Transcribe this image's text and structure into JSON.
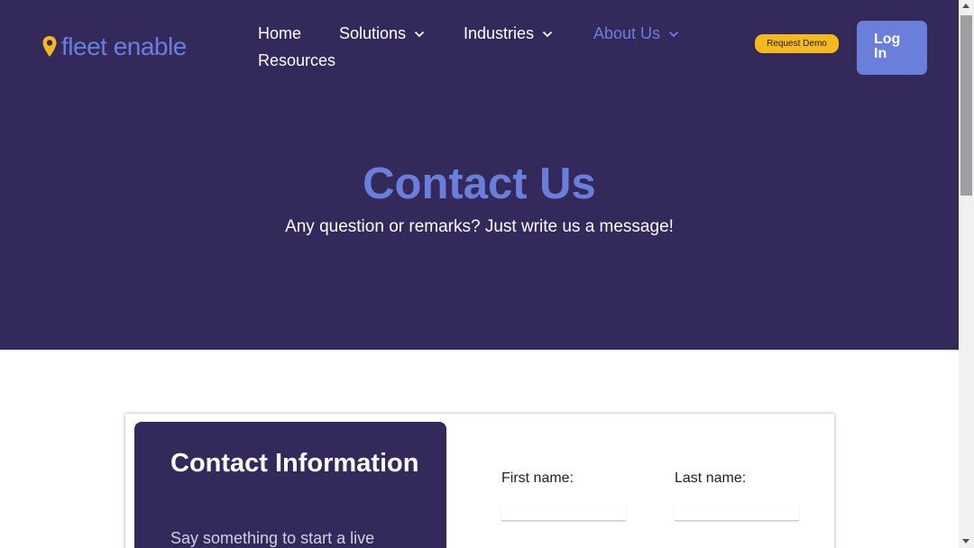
{
  "colors": {
    "hero_bg": "#33295b",
    "accent": "#6a7fdb",
    "demo_button": "#f5b91e",
    "logo_pin": "#f5b91e"
  },
  "header": {
    "logo_text": "fleet enable",
    "logo_icon": "map-pin-icon",
    "nav": [
      {
        "label": "Home",
        "has_dropdown": false
      },
      {
        "label": "Solutions",
        "has_dropdown": true
      },
      {
        "label": "Industries",
        "has_dropdown": true
      },
      {
        "label": "About Us",
        "has_dropdown": true,
        "active": true
      },
      {
        "label": "Resources",
        "has_dropdown": false
      }
    ],
    "request_demo_label": "Request Demo",
    "login_label_line1": "Log",
    "login_label_line2": "In"
  },
  "hero": {
    "title": "Contact Us",
    "subtitle": "Any question or remarks? Just write us a message!"
  },
  "contact_card": {
    "info_title": "Contact Information",
    "info_text": "Say something to start a live",
    "form": {
      "first_name_label": "First name:",
      "first_name_value": "",
      "last_name_label": "Last name:",
      "last_name_value": ""
    }
  }
}
